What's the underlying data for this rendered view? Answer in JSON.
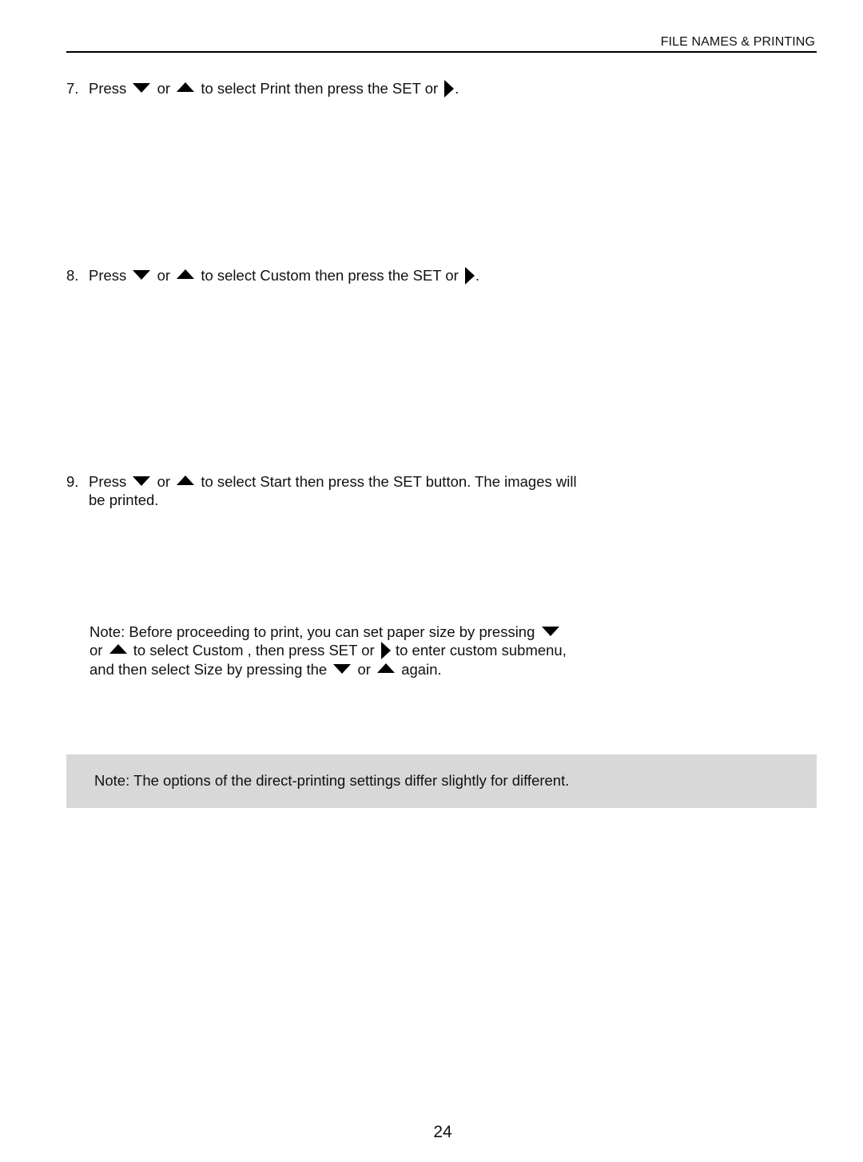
{
  "header": {
    "title": "FILE NAMES & PRINTING"
  },
  "steps": [
    {
      "num": "7.",
      "press": "Press",
      "or": "or",
      "text": "to select Print  then press the SET or",
      "end": "."
    },
    {
      "num": "8.",
      "press": "Press",
      "or": "or",
      "text": "to select Custom  then press the SET or",
      "end": "."
    },
    {
      "num": "9.",
      "press": "Press",
      "or": "or",
      "text": "to select Start  then press the SET button. The images will",
      "cont": "be printed."
    }
  ],
  "note_paragraph": {
    "part1": "Note:  Before proceeding to print, you can set paper size by pressing",
    "part2": "or",
    "part3": "to select Custom , then press SET or",
    "part4": "to enter custom submenu,",
    "part5": "and then select Size by pressing the",
    "part6": "or",
    "part7": "again."
  },
  "note_box": {
    "text": "Note:  The options of the direct-printing settings differ slightly for different."
  },
  "page_number": "24",
  "icons": {
    "down": "down-arrow-icon",
    "up": "up-arrow-icon",
    "right": "right-arrow-icon"
  }
}
